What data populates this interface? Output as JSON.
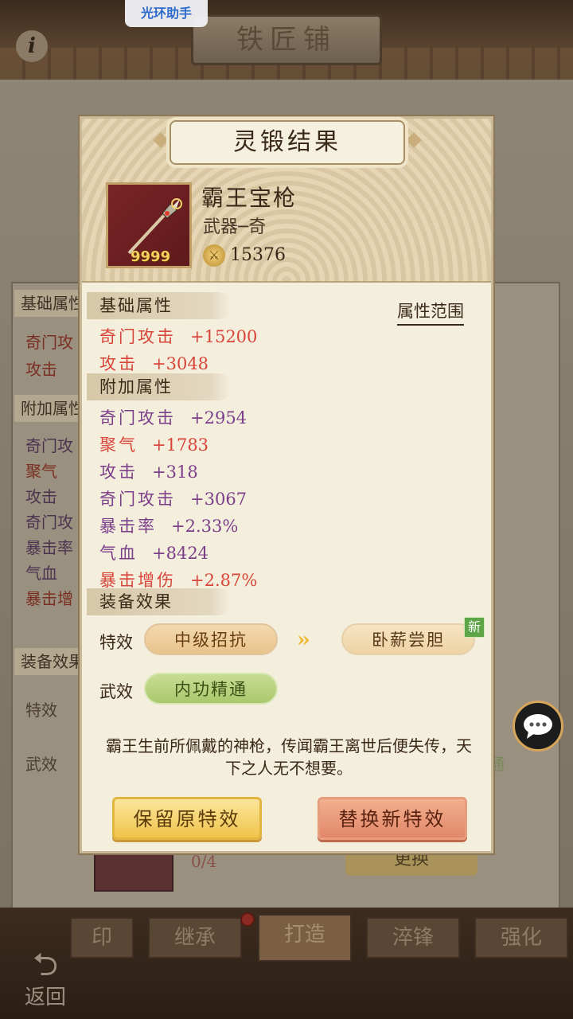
{
  "overlay": {
    "assistant_badge": "光环助手"
  },
  "background": {
    "shop_title": "铁匠铺",
    "info_icon": "i",
    "side_head_basic": "基础属性",
    "side_head_extra": "附加属性",
    "side_head_equip": "装备效果",
    "side_basic": [
      "奇门攻",
      "攻击"
    ],
    "side_extra": [
      "奇门攻",
      "聚气",
      "攻击",
      "奇门攻",
      "暴击率",
      "气血",
      "暴击增"
    ],
    "side_effect_labels": [
      "特效",
      "武效"
    ],
    "material_count": "0/4",
    "bg_button": "更换",
    "bg_pill": "通",
    "tabs": [
      "印",
      "继承",
      "打造",
      "淬锋",
      "强化"
    ],
    "active_tab": "打造",
    "back_label": "返回"
  },
  "modal": {
    "title": "灵锻结果",
    "item": {
      "name": "霸王宝枪",
      "type": "武器─奇",
      "count": "9999",
      "power": "15376"
    },
    "range_link": "属性范围",
    "basic_title": "基础属性",
    "basic_stats": [
      {
        "name": "奇门攻击",
        "value": "+15200",
        "color": "#d8453a"
      },
      {
        "name": "攻击",
        "value": "+3048",
        "color": "#d8453a"
      }
    ],
    "extra_title": "附加属性",
    "extra_stats": [
      {
        "name": "奇门攻击",
        "value": "+2954",
        "color": "#7b3f8a"
      },
      {
        "name": "聚气",
        "value": "+1783",
        "color": "#d8453a"
      },
      {
        "name": "攻击",
        "value": "+318",
        "color": "#7b3f8a"
      },
      {
        "name": "奇门攻击",
        "value": "+3067",
        "color": "#7b3f8a"
      },
      {
        "name": "暴击率",
        "value": "+2.33%",
        "color": "#7b3f8a"
      },
      {
        "name": "气血",
        "value": "+8424",
        "color": "#7b3f8a"
      },
      {
        "name": "暴击增伤",
        "value": "+2.87%",
        "color": "#d8453a"
      }
    ],
    "equip_title": "装备效果",
    "special_label": "特效",
    "special_old": "中级招抗",
    "special_new": "卧薪尝胆",
    "new_badge": "新",
    "weapon_label": "武效",
    "weapon_effect": "内功精通",
    "description": "霸王生前所佩戴的神枪，传闻霸王离世后便失传，天下之人无不想要。",
    "keep_button": "保留原特效",
    "replace_button": "替换新特效"
  }
}
